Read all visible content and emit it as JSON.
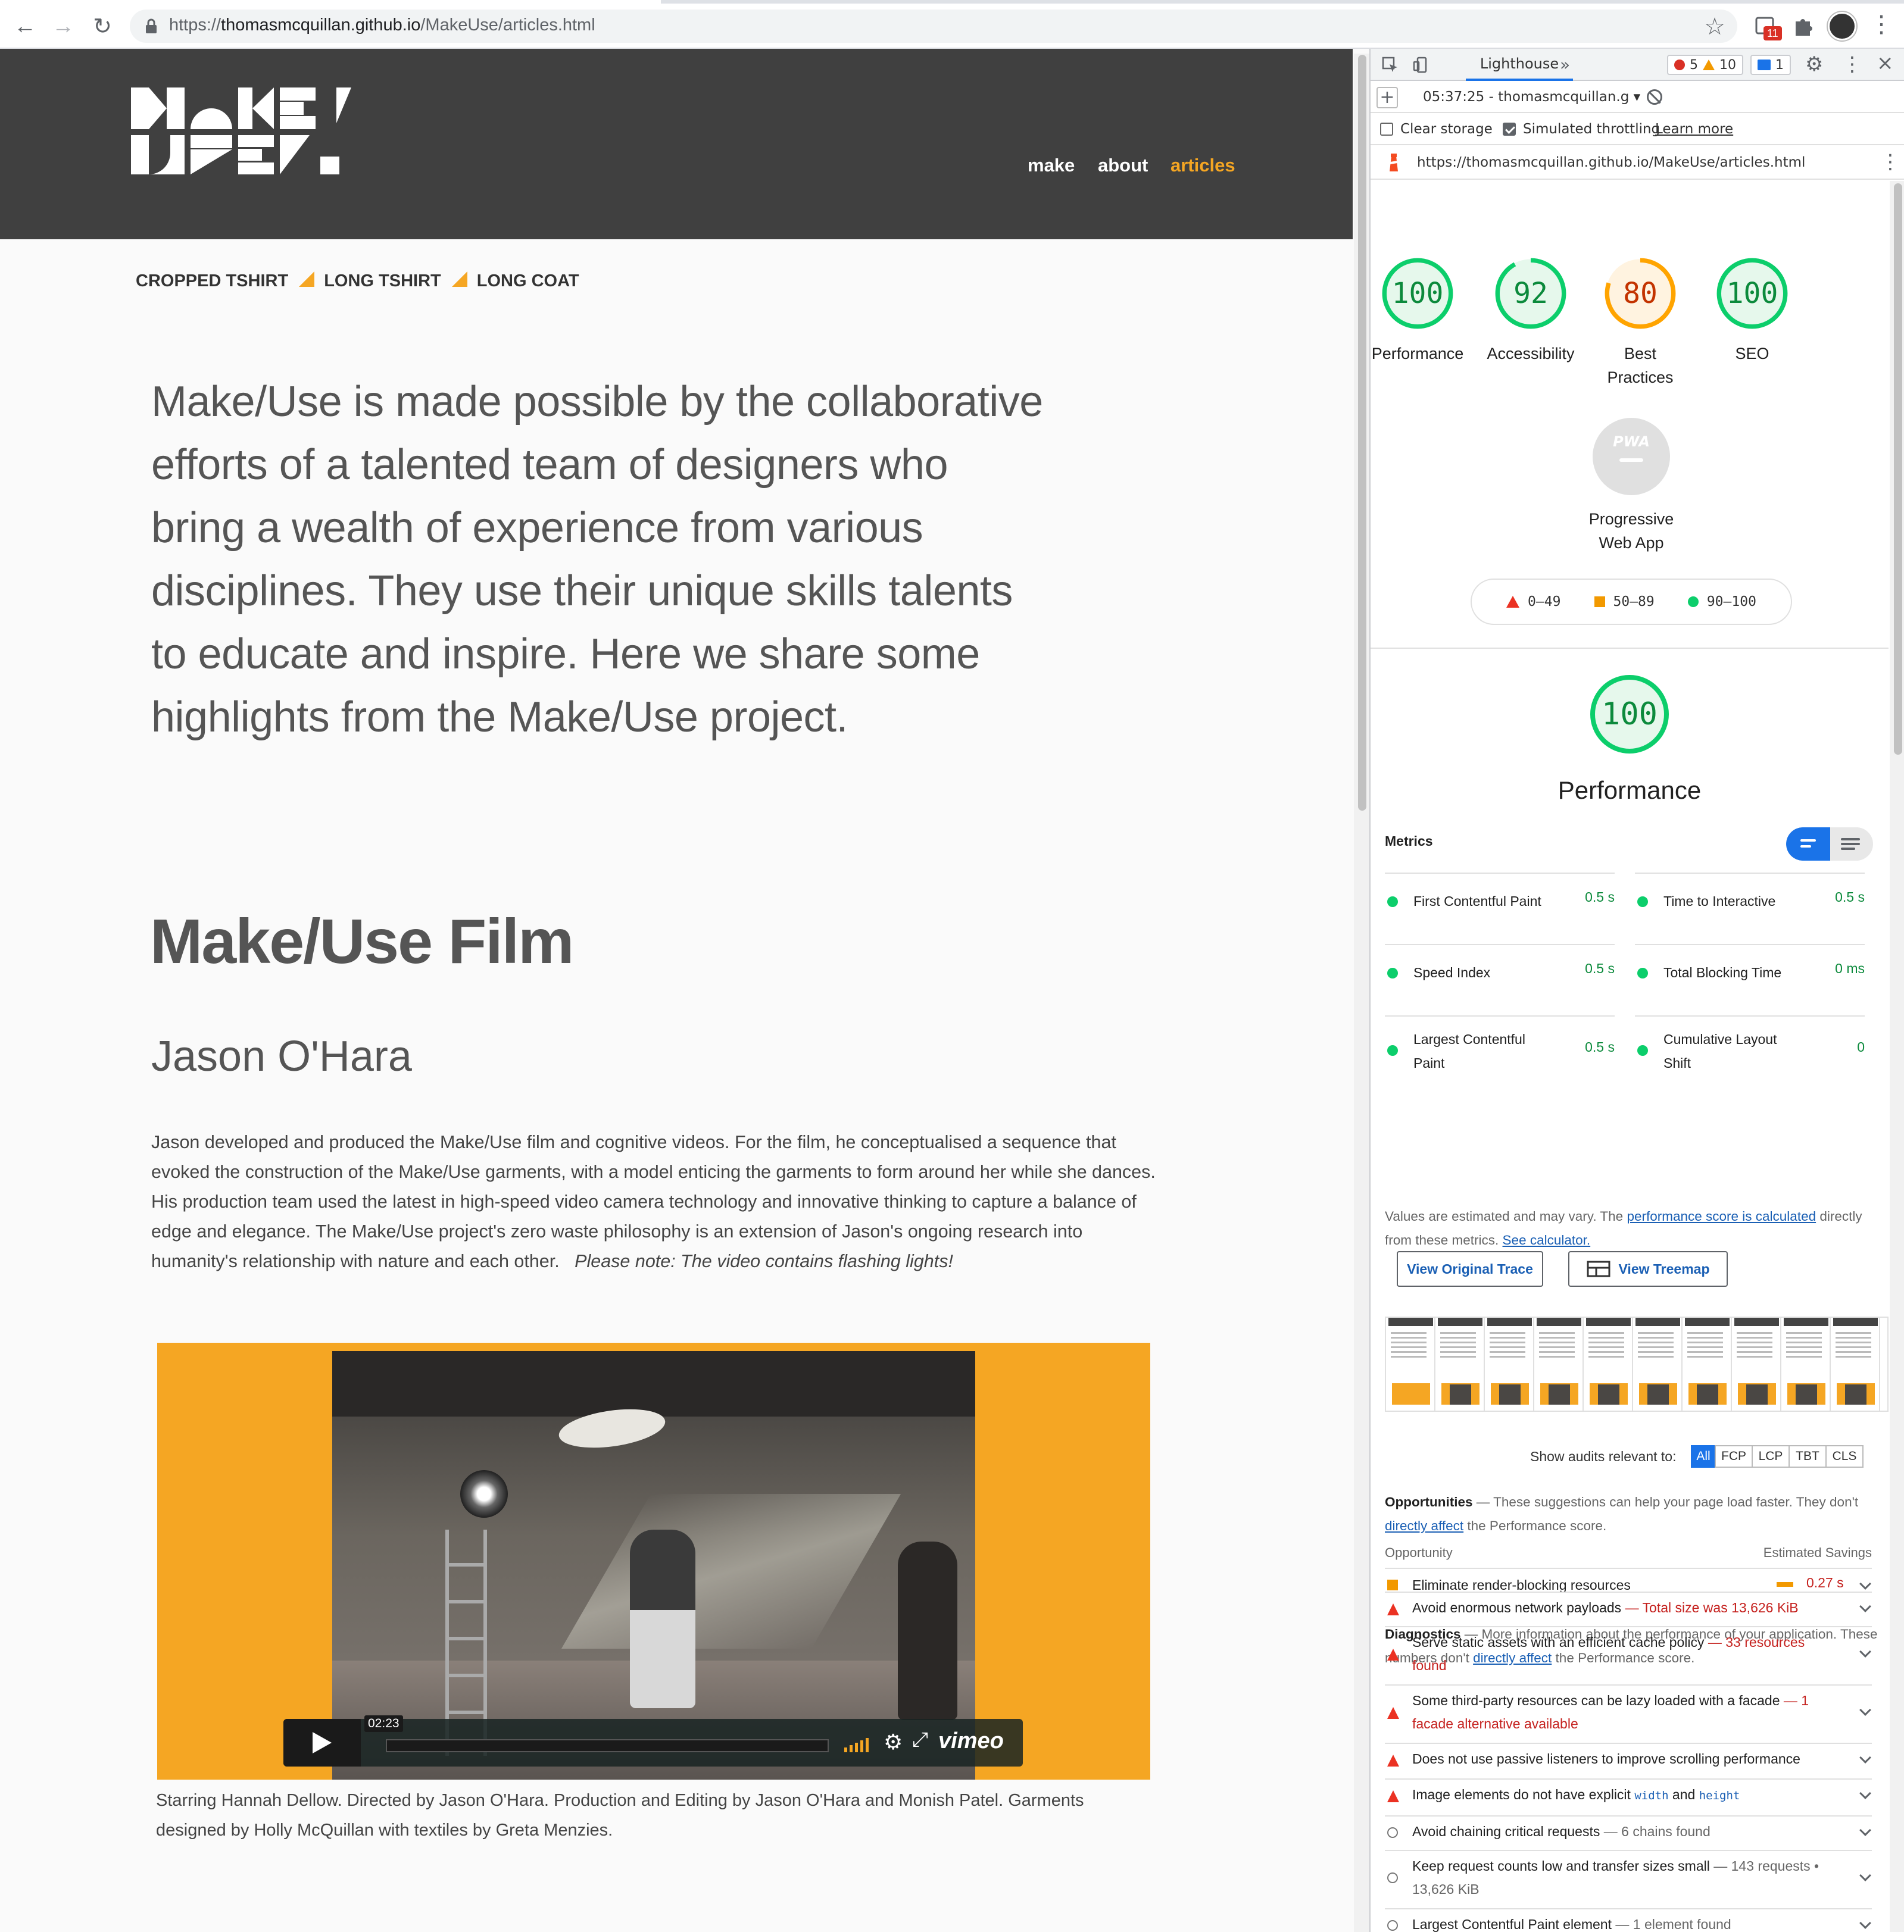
{
  "browser": {
    "url_scheme": "https://",
    "url_host": "thomasmcquillan.github.io",
    "url_path": "/MakeUse/articles.html",
    "extension_badge": "11"
  },
  "site": {
    "nav": [
      "make",
      "about",
      "articles"
    ],
    "breadcrumbs": [
      "CROPPED TSHIRT",
      "LONG TSHIRT",
      "LONG COAT"
    ],
    "intro": "Make/Use is made possible by the collaborative efforts of a talented team of designers who bring a wealth of experience from various disciplines. They use their unique skills talents to educate and inspire. Here we share some highlights from the Make/Use project.",
    "h1": "Make/Use Film",
    "h2": "Jason O'Hara",
    "paragraph": "Jason developed and produced the Make/Use film and cognitive videos. For the film, he conceptualised a sequence that evoked the construction of the Make/Use garments, with a model enticing the garments to form around her while she dances. His production team used the latest in high-speed video camera technology and innovative thinking to capture a balance of edge and elegance. The Make/Use project's zero waste philosophy is an extension of Jason's ongoing research into humanity's relationship with nature and each other.",
    "paragraph_note": "Please note: The video contains flashing lights!",
    "video": {
      "time": "02:23",
      "brand": "vimeo"
    },
    "credits": "Starring Hannah Dellow. Directed by Jason O'Hara. Production and Editing by Jason O'Hara and Monish Patel. Garments designed by Holly McQuillan with textiles by Greta Menzies.",
    "accent_color": "#f5a623",
    "header_color": "#404040"
  },
  "devtools": {
    "tab": "Lighthouse",
    "errors": "5",
    "warnings": "10",
    "messages": "1",
    "report_label": "05:37:25 - thomasmcquillan.g ▾",
    "clear_storage": "Clear storage",
    "throttling": "Simulated throttling",
    "learn_more": "Learn more",
    "audited_url": "https://thomasmcquillan.github.io/MakeUse/articles.html"
  },
  "lighthouse": {
    "scores": [
      {
        "label": "Performance",
        "score": "100",
        "value": 100,
        "color": "#0cce6b",
        "text_color": "#0c8a3c",
        "bg": "#e6f8ec"
      },
      {
        "label": "Accessibility",
        "score": "92",
        "value": 92,
        "color": "#0cce6b",
        "text_color": "#0c8a3c",
        "bg": "#e6f8ec"
      },
      {
        "label": "Best Practices",
        "score": "80",
        "value": 80,
        "color": "#ffa400",
        "text_color": "#c33300",
        "bg": "#fff3e0"
      },
      {
        "label": "SEO",
        "score": "100",
        "value": 100,
        "color": "#0cce6b",
        "text_color": "#0c8a3c",
        "bg": "#e6f8ec"
      }
    ],
    "pwa_label": "Progressive Web App",
    "pwa_badge": "PWA",
    "legend": [
      "0–49",
      "50–89",
      "90–100"
    ],
    "performance_score": "100",
    "performance_title": "Performance",
    "metrics_heading": "Metrics",
    "metrics": [
      {
        "name": "First Contentful Paint",
        "value": "0.5 s"
      },
      {
        "name": "Time to Interactive",
        "value": "0.5 s"
      },
      {
        "name": "Speed Index",
        "value": "0.5 s"
      },
      {
        "name": "Total Blocking Time",
        "value": "0 ms"
      },
      {
        "name": "Largest Contentful Paint",
        "value": "0.5 s"
      },
      {
        "name": "Cumulative Layout Shift",
        "value": "0"
      }
    ],
    "note_1": "Values are estimated and may vary. The ",
    "note_link_1": "performance score is calculated",
    "note_2": " directly from these metrics. ",
    "note_link_2": "See calculator.",
    "btn_trace": "View Original Trace",
    "btn_treemap": "View Treemap",
    "filter_label": "Show audits relevant to:",
    "filters": [
      "All",
      "FCP",
      "LCP",
      "TBT",
      "CLS"
    ],
    "opportunities_title": "Opportunities",
    "opportunities_desc_1": " — These suggestions can help your page load faster. They don't ",
    "opportunities_link": "directly affect",
    "opportunities_desc_2": " the Performance score.",
    "col_opportunity": "Opportunity",
    "col_savings": "Estimated Savings",
    "opportunity": {
      "title": "Eliminate render-blocking resources",
      "savings": "0.27 s"
    },
    "diagnostics_title": "Diagnostics",
    "diagnostics_desc_1": " — More information about the performance of your application. These numbers don't ",
    "diagnostics_link": "directly affect",
    "diagnostics_desc_2": " the Performance score.",
    "diagnostics": [
      {
        "title": "Avoid enormous network payloads",
        "detail": "— Total size was 13,626 KiB",
        "kind": "fail"
      },
      {
        "title": "Serve static assets with an efficient cache policy",
        "detail": "— 33 resources found",
        "kind": "fail"
      },
      {
        "title": "Some third-party resources can be lazy loaded with a facade",
        "detail": "— 1 facade alternative available",
        "kind": "fail"
      },
      {
        "title": "Does not use passive listeners to improve scrolling performance",
        "detail": "",
        "kind": "fail"
      },
      {
        "title": "Image elements do not have explicit",
        "code1": "width",
        "and": "and",
        "code2": "height",
        "kind": "fail"
      },
      {
        "title": "Avoid chaining critical requests",
        "detail": "— 6 chains found",
        "kind": "info"
      },
      {
        "title": "Keep request counts low and transfer sizes small",
        "detail": "— 143 requests • 13,626 KiB",
        "kind": "info"
      },
      {
        "title": "Largest Contentful Paint element",
        "detail": "— 1 element found",
        "kind": "info"
      }
    ]
  }
}
